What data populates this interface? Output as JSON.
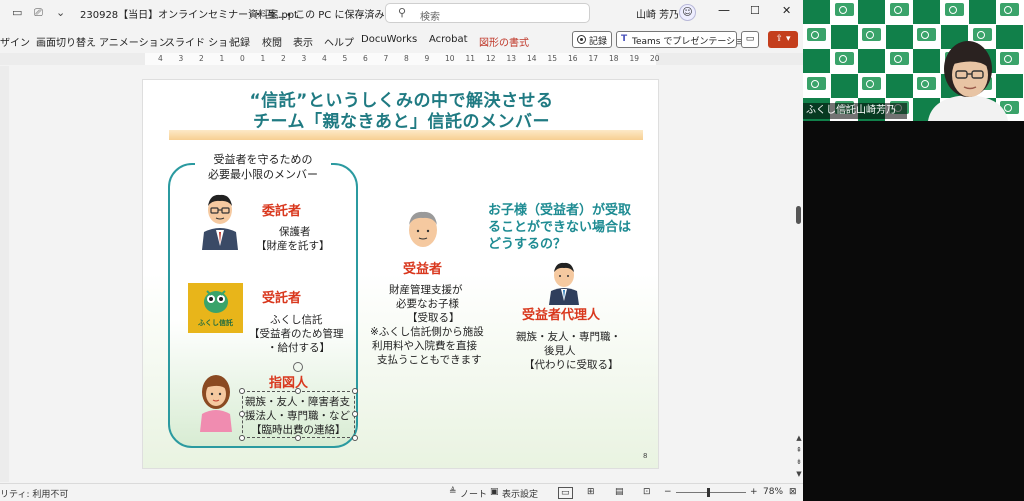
{
  "window": {
    "filename": "230928【当日】オンラインセミナー資料案.ppt",
    "suffix": "・ 互…",
    "save_status": "• この PC に保存済み",
    "search_placeholder": "検索",
    "user_name": "山崎 芳乃",
    "controls": {
      "minimize": "—",
      "maximize": "☐",
      "close": "✕"
    }
  },
  "ribbon": {
    "tabs": [
      "ザイン",
      "画面切り替え",
      "アニメーション",
      "スライド ショー",
      "記録",
      "校閲",
      "表示",
      "ヘルプ",
      "DocuWorks",
      "Acrobat",
      "図形の書式"
    ],
    "record_label": "記録",
    "teams_label": "Teams でプレゼンテーション",
    "share_label": "▾"
  },
  "ruler": {
    "marks": [
      "4",
      "3",
      "2",
      "1",
      "0",
      "1",
      "2",
      "3",
      "4",
      "5",
      "6",
      "7",
      "8",
      "9",
      "10",
      "11",
      "12",
      "13",
      "14",
      "15",
      "16",
      "17",
      "18",
      "19",
      "20"
    ]
  },
  "slide": {
    "title_line1": "“信託”というしくみの中で解決させる",
    "title_line2": "チーム「親なきあと」信託のメンバー",
    "box_label_line1": "受益者を守るための",
    "box_label_line2": "必要最小限のメンバー",
    "settlor_role": "委託者",
    "settlor_desc1": "保護者",
    "settlor_desc2": "【財産を託す】",
    "trustee_role": "受託者",
    "trustee_desc1": "ふくし信託",
    "trustee_desc2": "【受益者のため管理",
    "trustee_desc3": "・給付する】",
    "trustee_logo_text": "ふくし信託",
    "director_role": "指図人",
    "director_desc1": "親族・友人・障害者支",
    "director_desc2": "援法人・専門職・など",
    "director_desc3": "【臨時出費の連絡】",
    "beneficiary_role": "受益者",
    "beneficiary_desc1": "財産管理支援が",
    "beneficiary_desc2": "必要なお子様",
    "beneficiary_desc3": "【受取る】",
    "beneficiary_note1": "※ふくし信託側から施設",
    "beneficiary_note2": "利用料や入院費を直接",
    "beneficiary_note3": "支払うこともできます",
    "question_line1": "お子様（受益者）が受取",
    "question_line2": "ることができない場合は",
    "question_line3": "どうするの？",
    "agent_role": "受益者代理人",
    "agent_desc1": "親族・友人・専門職・",
    "agent_desc2": "後見人",
    "agent_desc3": "【代わりに受取る】",
    "page_number": "8"
  },
  "status": {
    "accessibility": "リティ: 利用不可",
    "notes": "ノート",
    "display_settings": "表示設定",
    "zoom_minus": "−",
    "zoom_plus": "+",
    "zoom_level": "78%"
  },
  "video": {
    "participant_name": "ふくし信託山崎芳乃",
    "brand_colors": {
      "green": "#11804a",
      "white": "#ffffff"
    }
  },
  "colors": {
    "title_teal": "#1f7a82",
    "role_red": "#d9381e",
    "question_teal": "#1f8c93",
    "share_orange": "#c43e1c"
  }
}
